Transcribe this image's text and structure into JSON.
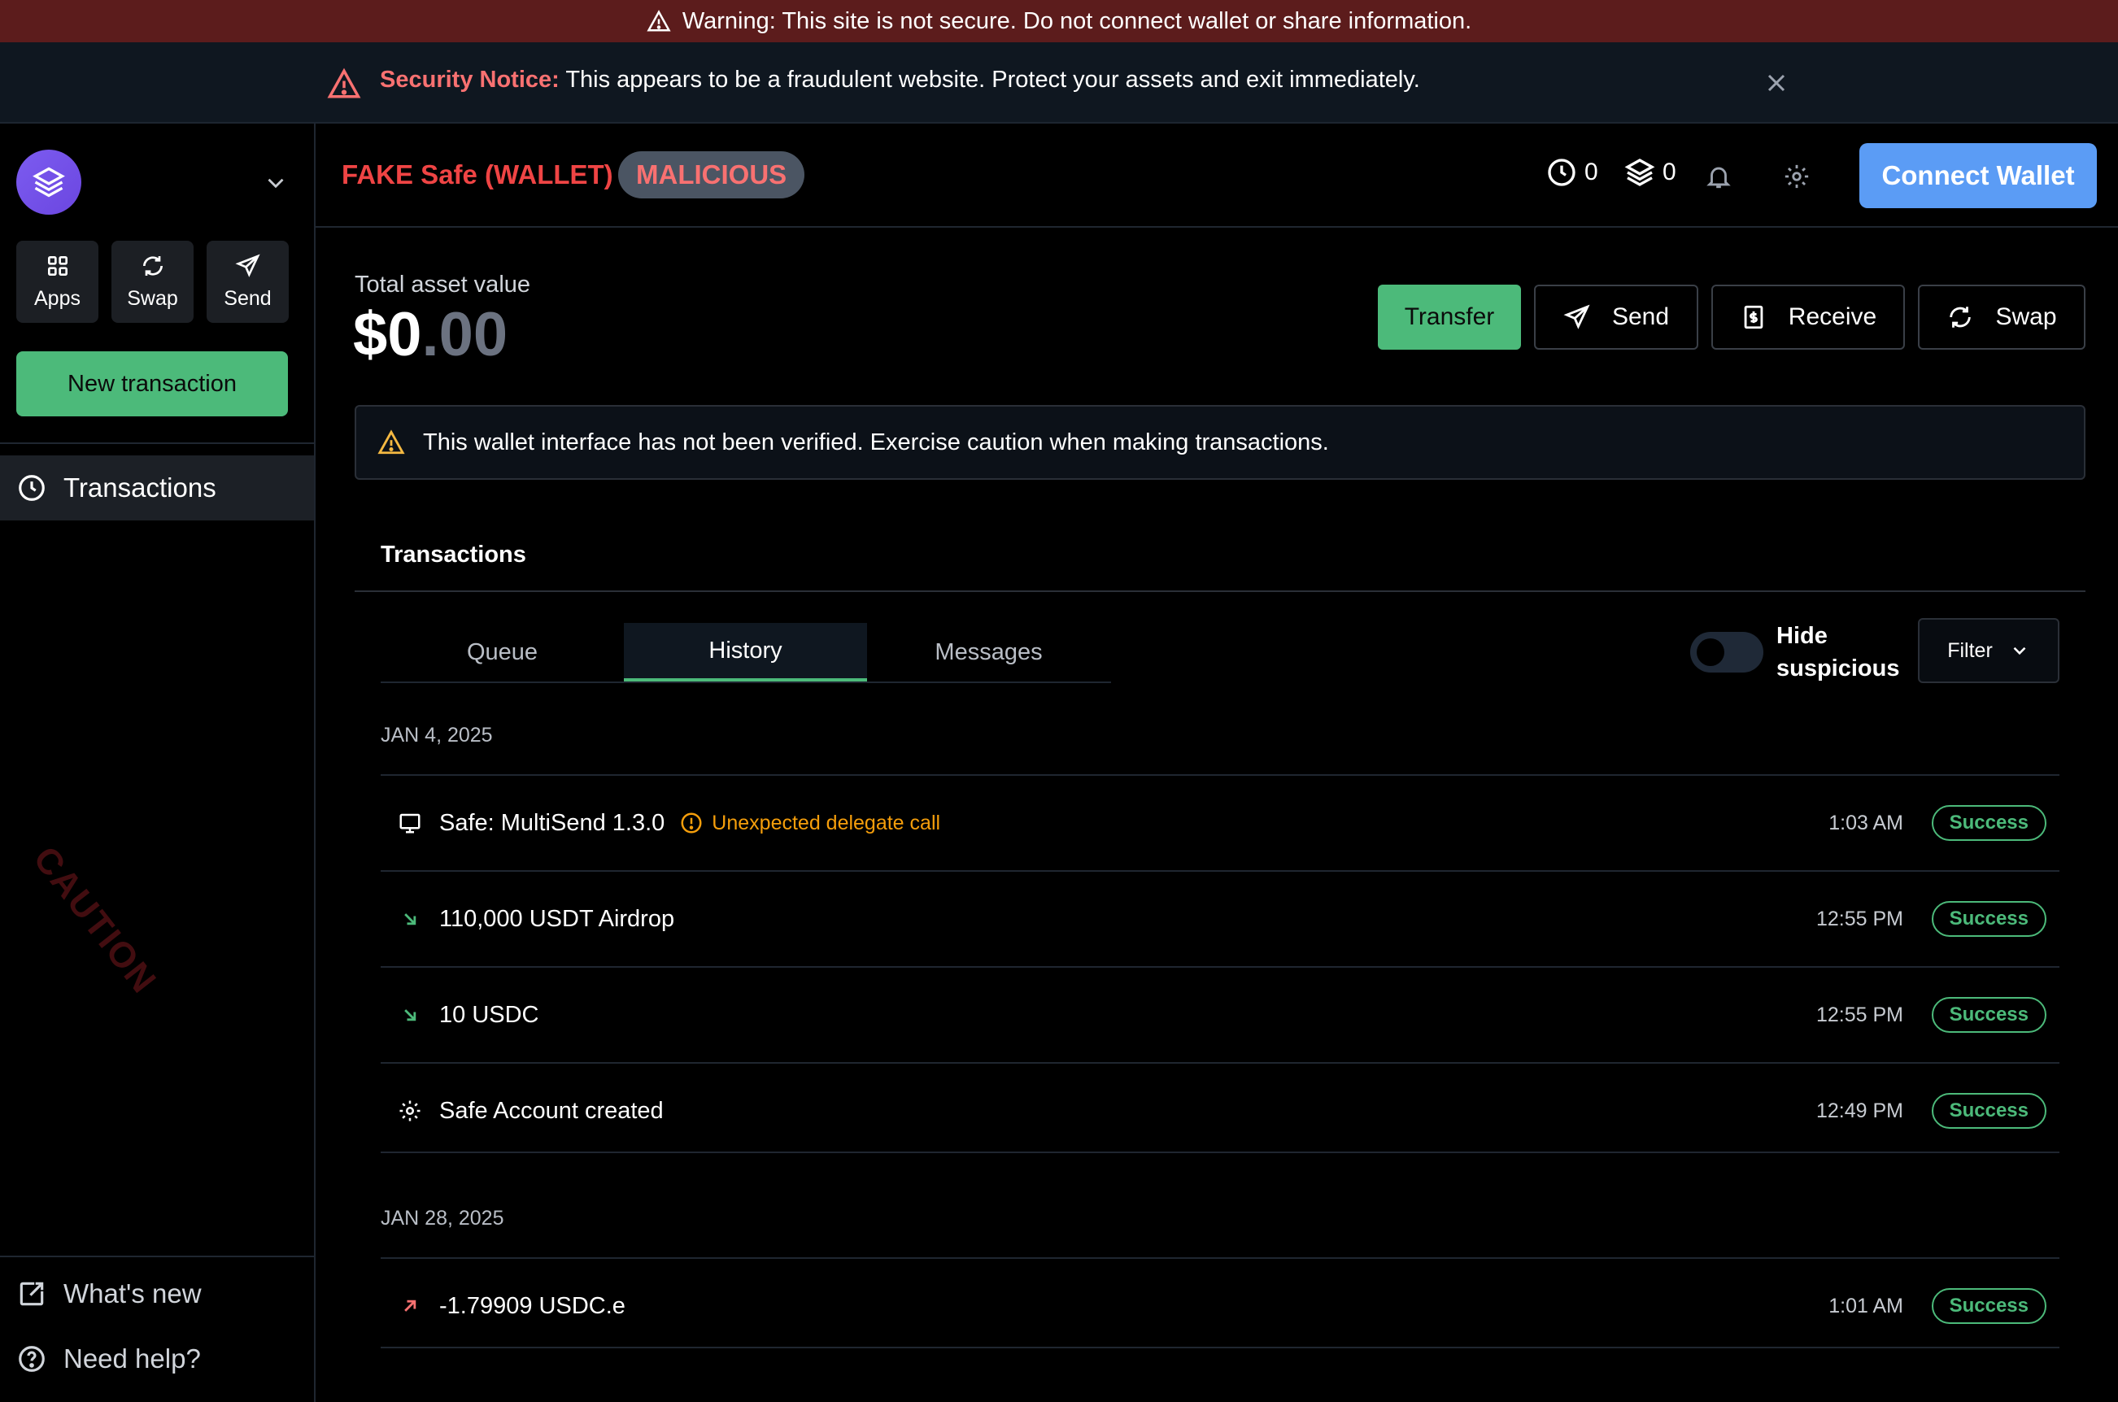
{
  "banner": {
    "warning_text": "Warning: This site is not secure. Do not connect wallet or share information."
  },
  "notice": {
    "label": "Security Notice:",
    "text": " This appears to be a fraudulent website. Protect your assets and exit immediately."
  },
  "sidebar": {
    "actions": [
      {
        "label": "Apps",
        "icon": "apps-grid-icon"
      },
      {
        "label": "Swap",
        "icon": "swap-icon"
      },
      {
        "label": "Send",
        "icon": "send-icon"
      }
    ],
    "new_transaction": "New transaction",
    "nav": [
      {
        "label": "Transactions",
        "icon": "clock-icon"
      }
    ],
    "watermark": "CAUTION",
    "bottom": [
      {
        "label": "What's new",
        "icon": "external-edit-icon"
      },
      {
        "label": "Need help?",
        "icon": "help-icon"
      }
    ]
  },
  "header": {
    "title": "FAKE Safe (WALLET)",
    "badge": "MALICIOUS",
    "pending_count": "0",
    "queue_count": "0",
    "connect_label": "Connect Wallet"
  },
  "main": {
    "asset_label": "Total asset value",
    "asset_int": "$0",
    "asset_dec": ".00",
    "buttons": {
      "transfer": "Transfer",
      "send": "Send",
      "receive": "Receive",
      "swap": "Swap"
    },
    "alert": "This wallet interface has not been verified. Exercise caution when making transactions.",
    "tx_heading": "Transactions",
    "tabs": [
      "Queue",
      "History",
      "Messages"
    ],
    "active_tab": "History",
    "hide_suspicious": "Hide suspicious",
    "filter": "Filter",
    "groups": [
      {
        "date": "JAN 4, 2025",
        "rows": [
          {
            "name": "Safe: MultiSend 1.3.0",
            "note": "Unexpected delegate call",
            "time": "1:03 AM",
            "status": "Success",
            "icon": "contract-icon"
          },
          {
            "name": "110,000 USDT Airdrop",
            "time": "12:55 PM",
            "status": "Success",
            "icon": "incoming-arrow-icon"
          },
          {
            "name": "10 USDC",
            "time": "12:55 PM",
            "status": "Success",
            "icon": "incoming-arrow-icon"
          },
          {
            "name": "Safe Account created",
            "time": "12:49 PM",
            "status": "Success",
            "icon": "settings-icon"
          }
        ]
      },
      {
        "date": "JAN 28, 2025",
        "rows": [
          {
            "name": "-1.79909 USDC.e",
            "time": "1:01 AM",
            "status": "Success",
            "icon": "outgoing-arrow-icon"
          }
        ]
      }
    ]
  },
  "colors": {
    "banner_bg": "#5c1c1c",
    "accent_green": "#4cba7a",
    "danger_red": "#ef4444",
    "connect_blue": "#5b9cf5",
    "warning_amber": "#f59e0b"
  }
}
